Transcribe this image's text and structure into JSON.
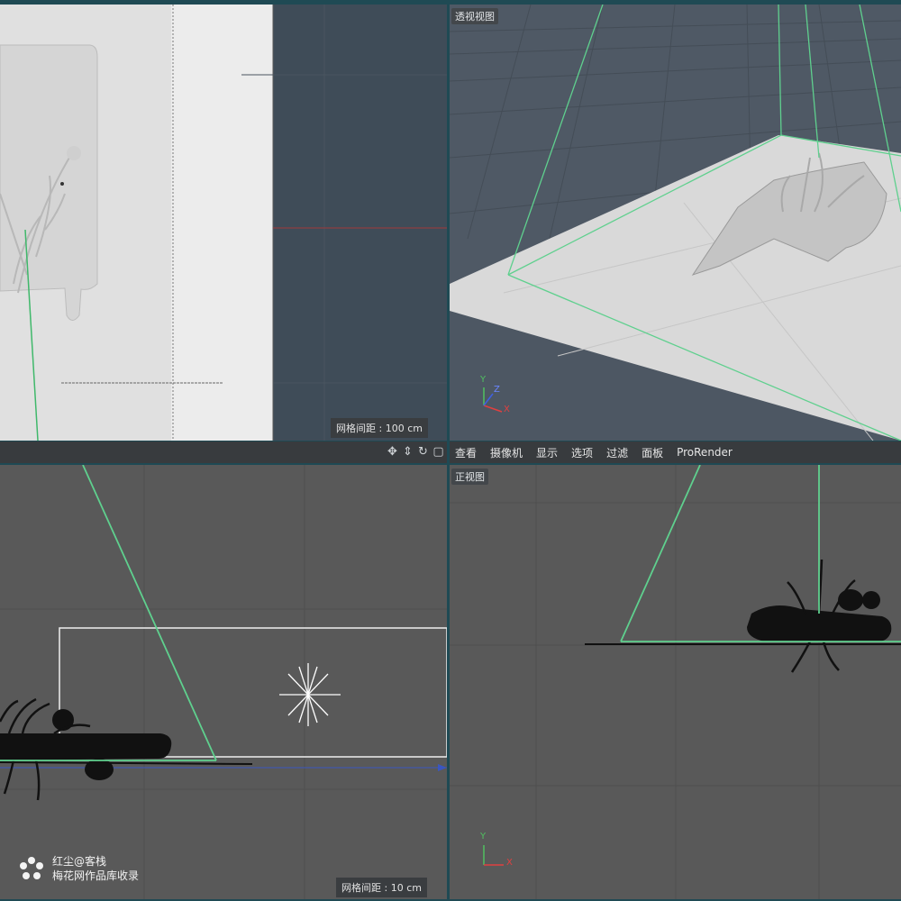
{
  "viewports": {
    "top_left": {
      "grid_spacing": "网格间距 : 100 cm"
    },
    "top_right": {
      "label": "透视视图",
      "axes": {
        "y": "Y",
        "z": "Z",
        "x": "X"
      }
    },
    "bottom_left": {
      "grid_spacing": "网格间距 : 10 cm"
    },
    "bottom_right": {
      "label": "正视图",
      "axes": {
        "y": "Y",
        "x": "X"
      }
    }
  },
  "menu": {
    "items": [
      "查看",
      "摄像机",
      "显示",
      "选项",
      "过滤",
      "面板",
      "ProRender"
    ]
  },
  "viewport_tools": [
    "move-icon",
    "zoom-icon",
    "rotate-icon",
    "maximize-icon"
  ],
  "watermark": {
    "line1": "红尘@客栈",
    "line2": "梅花网作品库收录"
  },
  "colors": {
    "camera_frustum": "#5fd08e",
    "axis_x": "#e04040",
    "axis_y": "#50c060",
    "axis_z": "#4060e0"
  }
}
